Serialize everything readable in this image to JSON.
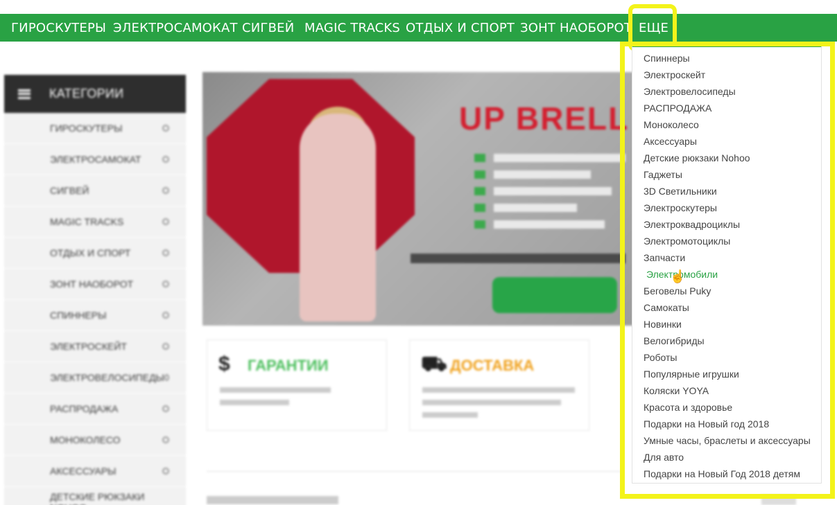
{
  "topnav": {
    "items": [
      "ГИРОСКУТЕРЫ",
      "ЭЛЕКТРОСАМОКАТ",
      "СИГВЕЙ",
      "MAGIC TRACKS",
      "ОТДЫХ И СПОРТ",
      "ЗОНТ НАОБОРОТ",
      "ЕЩЕ"
    ]
  },
  "sidebar": {
    "title": "КАТЕГОРИИ",
    "items": [
      "ГИРОСКУТЕРЫ",
      "ЭЛЕКТРОСАМОКАТ",
      "СИГВЕЙ",
      "MAGIC TRACKS",
      "ОТДЫХ И СПОРТ",
      "ЗОНТ НАОБОРОТ",
      "СПИННЕРЫ",
      "ЭЛЕКТРОСКЕЙТ",
      "ЭЛЕКТРОВЕЛОСИПЕДЫ",
      "РАСПРОДАЖА",
      "МОНОКОЛЕСО",
      "АКСЕССУАРЫ",
      "ДЕТСКИЕ РЮКЗАКИ NOHOO"
    ]
  },
  "banner": {
    "title": "UP BRELL"
  },
  "cards": [
    {
      "icon": "$",
      "title": "ГАРАНТИИ",
      "title_color": "#4cbf5d"
    },
    {
      "icon": "⛟",
      "title": "ДОСТАВКА",
      "title_color": "#f0a21e"
    }
  ],
  "dropdown": {
    "items": [
      "Спиннеры",
      "Электроскейт",
      "Электровелосипеды",
      "РАСПРОДАЖА",
      "Моноколесо",
      "Аксессуары",
      "Детские рюкзаки Nohoo",
      "Гаджеты",
      "3D Светильники",
      "Электроскутеры",
      "Электроквадроциклы",
      "Электромотоциклы",
      "Запчасти",
      "Электромобили",
      "Беговелы Puky",
      "Самокаты",
      "Новинки",
      "Велогибриды",
      "Роботы",
      "Популярные игрушки",
      "Коляски YOYA",
      "Красота и здоровье",
      "Подарки на Новый год 2018",
      "Умные часы, браслеты и аксессуары",
      "Для авто",
      "Подарки на Новый Год 2018 детям"
    ],
    "hover_index": 13
  },
  "colors": {
    "brand_green": "#29a244",
    "highlight_yellow": "#f3f31a"
  }
}
